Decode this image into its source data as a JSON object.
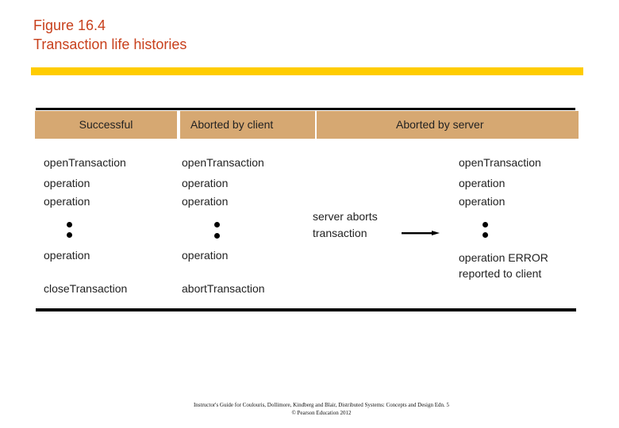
{
  "figure": {
    "number": "Figure 16.4",
    "title": "Transaction life histories"
  },
  "colors": {
    "title": "#C8401C",
    "accent_bar": "#FFCC00",
    "header_fill": "#D6A872",
    "rule": "#000000"
  },
  "columns": [
    {
      "header": "Successful",
      "steps": [
        "openTransaction",
        "operation",
        "operation",
        "operation",
        "closeTransaction"
      ]
    },
    {
      "header": "Aborted by client",
      "steps": [
        "openTransaction",
        "operation",
        "operation",
        "operation",
        "abortTransaction"
      ]
    },
    {
      "header": "Aborted by server",
      "steps": [
        "openTransaction",
        "operation",
        "operation",
        "operation ERROR",
        "reported to client"
      ],
      "event": [
        "server aborts",
        "transaction"
      ]
    }
  ],
  "ellipsis_icon": "vertical-dots",
  "arrow_icon": "right-arrow",
  "footer": {
    "line1": "Instructor's Guide for  Coulouris, Dollimore, Kindberg and Blair,  Distributed Systems: Concepts and Design   Edn. 5",
    "line2": "© Pearson Education 2012"
  }
}
